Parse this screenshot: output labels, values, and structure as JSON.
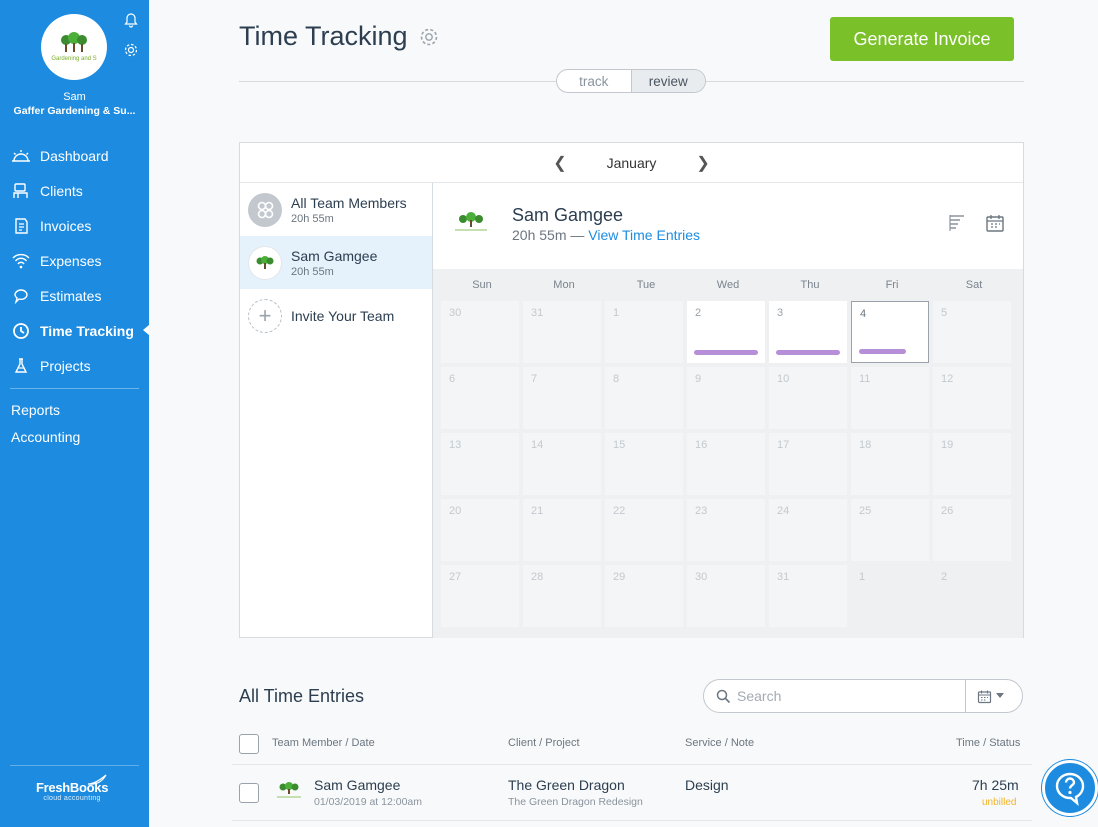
{
  "sidebar": {
    "user_name": "Sam",
    "business_name": "Gaffer Gardening & Su...",
    "logo_text": "Gardening and S",
    "nav": [
      {
        "label": "Dashboard",
        "icon": "dashboard-icon"
      },
      {
        "label": "Clients",
        "icon": "clients-icon"
      },
      {
        "label": "Invoices",
        "icon": "invoices-icon"
      },
      {
        "label": "Expenses",
        "icon": "expenses-icon"
      },
      {
        "label": "Estimates",
        "icon": "estimates-icon"
      },
      {
        "label": "Time Tracking",
        "icon": "clock-icon",
        "active": true
      },
      {
        "label": "Projects",
        "icon": "projects-icon"
      }
    ],
    "links": [
      "Reports",
      "Accounting"
    ],
    "brand": "FreshBooks",
    "brand_sub": "cloud accounting"
  },
  "header": {
    "title": "Time Tracking",
    "generate_button": "Generate Invoice",
    "toggle": {
      "track": "track",
      "review": "review",
      "selected": "review"
    }
  },
  "calendar": {
    "month": "January",
    "team": [
      {
        "name": "All Team Members",
        "hours": "20h 55m"
      },
      {
        "name": "Sam Gamgee",
        "hours": "20h 55m"
      }
    ],
    "invite_label": "Invite Your Team",
    "person": {
      "name": "Sam Gamgee",
      "hours": "20h 55m",
      "separator": " — ",
      "link": "View Time Entries"
    },
    "day_headers": [
      "Sun",
      "Mon",
      "Tue",
      "Wed",
      "Thu",
      "Fri",
      "Sat"
    ],
    "days": [
      "30",
      "31",
      "1",
      "2",
      "3",
      "4",
      "5",
      "6",
      "7",
      "8",
      "9",
      "10",
      "11",
      "12",
      "13",
      "14",
      "15",
      "16",
      "17",
      "18",
      "19",
      "20",
      "21",
      "22",
      "23",
      "24",
      "25",
      "26",
      "27",
      "28",
      "29",
      "30",
      "31",
      "1",
      "2"
    ]
  },
  "entries": {
    "title": "All Time Entries",
    "search_placeholder": "Search",
    "columns": {
      "member": "Team Member / Date",
      "client": "Client / Project",
      "service": "Service / Note",
      "time": "Time / Status"
    },
    "rows": [
      {
        "member": "Sam Gamgee",
        "date": "01/03/2019 at 12:00am",
        "client": "The Green Dragon",
        "project": "The Green Dragon Redesign",
        "service": "Design",
        "time": "7h 25m",
        "status": "unbilled"
      }
    ]
  },
  "colors": {
    "brand_blue": "#1d8ce0",
    "accent_green": "#7ac029",
    "entry_bar": "#b78fd9",
    "unbilled": "#f0b429"
  }
}
